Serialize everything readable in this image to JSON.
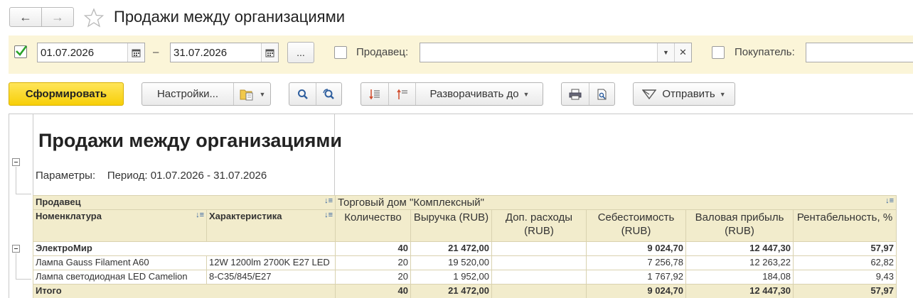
{
  "window": {
    "title": "Продажи между организациями",
    "back_icon": "arrow-left-icon",
    "forward_icon": "arrow-right-icon",
    "favorite_icon": "star-icon"
  },
  "filters": {
    "period_enabled": true,
    "date_from": "01.07.2026",
    "dash": "–",
    "date_to": "31.07.2026",
    "period_button_label": "...",
    "seller_enabled": false,
    "seller_label": "Продавец:",
    "seller_value": "",
    "buyer_enabled": false,
    "buyer_label": "Покупатель:",
    "buyer_value": ""
  },
  "toolbar": {
    "generate_label": "Сформировать",
    "settings_label": "Настройки...",
    "expand_to_label": "Разворачивать до",
    "send_label": "Отправить"
  },
  "report": {
    "title": "Продажи между организациями",
    "params_label": "Параметры:",
    "params_value": "Период: 01.07.2026 - 31.07.2026",
    "header": {
      "seller": "Продавец",
      "organization": "Торговый дом \"Комплексный\"",
      "nomenclature": "Номенклатура",
      "characteristic": "Характеристика",
      "quantity": "Количество",
      "revenue": "Выручка (RUB)",
      "extra_costs": "Доп. расходы (RUB)",
      "cost": "Себестоимость (RUB)",
      "gross_profit": "Валовая прибыль (RUB)",
      "profitability": "Рентабельность, %"
    },
    "group": {
      "name": "ЭлектроМир",
      "quantity": "40",
      "revenue": "21 472,00",
      "extra_costs": "",
      "cost": "9 024,70",
      "gross_profit": "12 447,30",
      "profitability": "57,97"
    },
    "rows": [
      {
        "nomenclature": "Лампа Gauss Filament A60",
        "characteristic": "12W 1200lm 2700K E27 LED",
        "quantity": "20",
        "revenue": "19 520,00",
        "extra_costs": "",
        "cost": "7 256,78",
        "gross_profit": "12 263,22",
        "profitability": "62,82"
      },
      {
        "nomenclature": "Лампа светодиодная LED Camelion",
        "characteristic": "8-C35/845/E27",
        "quantity": "20",
        "revenue": "1 952,00",
        "extra_costs": "",
        "cost": "1 767,92",
        "gross_profit": "184,08",
        "profitability": "9,43"
      }
    ],
    "total": {
      "label": "Итого",
      "quantity": "40",
      "revenue": "21 472,00",
      "extra_costs": "",
      "cost": "9 024,70",
      "gross_profit": "12 447,30",
      "profitability": "57,97"
    }
  },
  "colors": {
    "filter_bg": "#fbf5d8",
    "primary_button": "#f7cf08",
    "header_bg": "#f2eccc",
    "check_green": "#2aa32a"
  }
}
